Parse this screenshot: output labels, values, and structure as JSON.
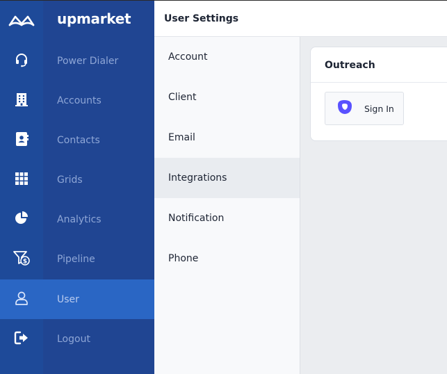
{
  "brand": {
    "name": "upmarket",
    "logo": "upmarket-logo-icon"
  },
  "sidebar": {
    "items": [
      {
        "label": "Power Dialer",
        "icon": "headset-icon",
        "active": false
      },
      {
        "label": "Accounts",
        "icon": "building-icon",
        "active": false
      },
      {
        "label": "Contacts",
        "icon": "contact-card-icon",
        "active": false
      },
      {
        "label": "Grids",
        "icon": "grid-icon",
        "active": false
      },
      {
        "label": "Analytics",
        "icon": "pie-chart-icon",
        "active": false
      },
      {
        "label": "Pipeline",
        "icon": "funnel-dollar-icon",
        "active": false
      },
      {
        "label": "User",
        "icon": "user-icon",
        "active": true
      },
      {
        "label": "Logout",
        "icon": "logout-icon",
        "active": false
      }
    ]
  },
  "settings": {
    "title": "User Settings",
    "items": [
      {
        "label": "Account",
        "active": false
      },
      {
        "label": "Client",
        "active": false
      },
      {
        "label": "Email",
        "active": false
      },
      {
        "label": "Integrations",
        "active": true
      },
      {
        "label": "Notification",
        "active": false
      },
      {
        "label": "Phone",
        "active": false
      }
    ]
  },
  "integration": {
    "title": "Outreach",
    "signin_label": "Sign In",
    "icon": "outreach-logo-icon"
  },
  "colors": {
    "rail": "#1e4a99",
    "panel": "#204592",
    "active": "#2a66c4",
    "outreach": "#5951ff"
  }
}
